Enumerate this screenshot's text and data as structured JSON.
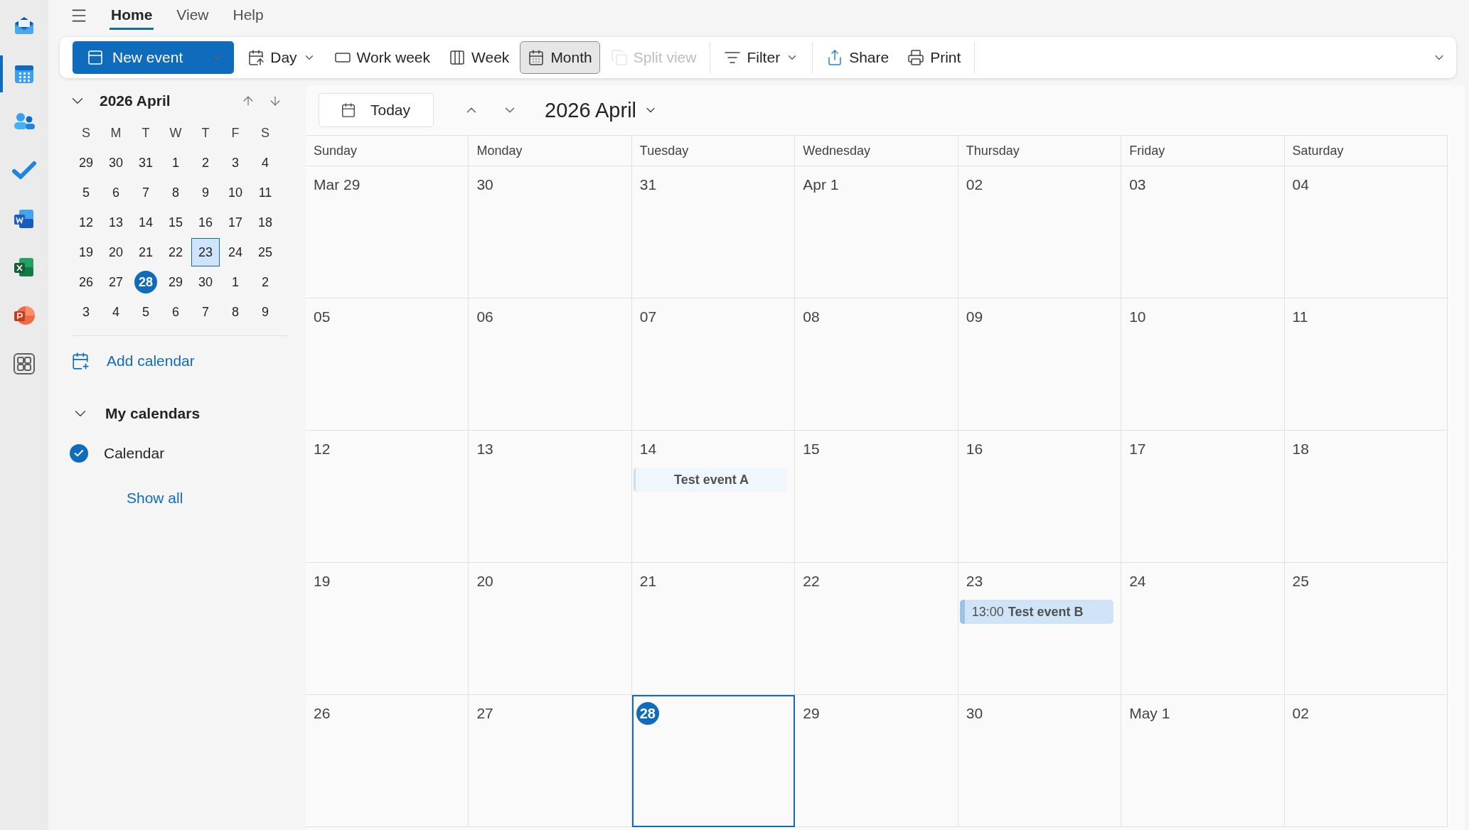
{
  "app_rail": [
    {
      "kind": "mail",
      "selected": false
    },
    {
      "kind": "calendar",
      "selected": true
    },
    {
      "kind": "people",
      "selected": false
    },
    {
      "kind": "todo",
      "selected": false
    },
    {
      "kind": "word",
      "selected": false
    },
    {
      "kind": "excel",
      "selected": false
    },
    {
      "kind": "powerpoint",
      "selected": false
    },
    {
      "kind": "apps",
      "selected": false
    }
  ],
  "menu_tabs": [
    {
      "label": "Home",
      "selected": true
    },
    {
      "label": "View",
      "selected": false
    },
    {
      "label": "Help",
      "selected": false
    }
  ],
  "toolbar": {
    "groups": [
      {
        "buttons": [
          {
            "label": "New event",
            "kind": "new",
            "dropdown": true,
            "selected": false,
            "disabled": false
          },
          {
            "label": "Day",
            "kind": "day",
            "dropdown": true,
            "selected": false,
            "disabled": false
          },
          {
            "label": "Work week",
            "kind": "workweek",
            "dropdown": false,
            "selected": false,
            "disabled": false
          },
          {
            "label": "Week",
            "kind": "week",
            "dropdown": false,
            "selected": false,
            "disabled": false
          },
          {
            "label": "Month",
            "kind": "month",
            "dropdown": false,
            "selected": true,
            "disabled": false
          },
          {
            "label": "Split view",
            "kind": "split",
            "dropdown": false,
            "selected": false,
            "disabled": true
          }
        ]
      },
      {
        "buttons": [
          {
            "label": "Filter",
            "kind": "filter",
            "dropdown": true,
            "selected": false,
            "disabled": false
          }
        ]
      },
      {
        "buttons": [
          {
            "label": "Share",
            "kind": "share",
            "dropdown": false,
            "selected": false,
            "disabled": false
          },
          {
            "label": "Print",
            "kind": "print",
            "dropdown": false,
            "selected": false,
            "disabled": false
          }
        ]
      }
    ]
  },
  "mini_calendar": {
    "title": "2026 April",
    "weekdays": [
      "S",
      "M",
      "T",
      "W",
      "T",
      "F",
      "S"
    ],
    "weeks": [
      {
        "days": [
          {
            "label": "29",
            "selected": false,
            "today": false
          },
          {
            "label": "30",
            "selected": false,
            "today": false
          },
          {
            "label": "31",
            "selected": false,
            "today": false
          },
          {
            "label": "1",
            "selected": false,
            "today": false
          },
          {
            "label": "2",
            "selected": false,
            "today": false
          },
          {
            "label": "3",
            "selected": false,
            "today": false
          },
          {
            "label": "4",
            "selected": false,
            "today": false
          }
        ]
      },
      {
        "days": [
          {
            "label": "5",
            "selected": false,
            "today": false
          },
          {
            "label": "6",
            "selected": false,
            "today": false
          },
          {
            "label": "7",
            "selected": false,
            "today": false
          },
          {
            "label": "8",
            "selected": false,
            "today": false
          },
          {
            "label": "9",
            "selected": false,
            "today": false
          },
          {
            "label": "10",
            "selected": false,
            "today": false
          },
          {
            "label": "11",
            "selected": false,
            "today": false
          }
        ]
      },
      {
        "days": [
          {
            "label": "12",
            "selected": false,
            "today": false
          },
          {
            "label": "13",
            "selected": false,
            "today": false
          },
          {
            "label": "14",
            "selected": false,
            "today": false
          },
          {
            "label": "15",
            "selected": false,
            "today": false
          },
          {
            "label": "16",
            "selected": false,
            "today": false
          },
          {
            "label": "17",
            "selected": false,
            "today": false
          },
          {
            "label": "18",
            "selected": false,
            "today": false
          }
        ]
      },
      {
        "days": [
          {
            "label": "19",
            "selected": false,
            "today": false
          },
          {
            "label": "20",
            "selected": false,
            "today": false
          },
          {
            "label": "21",
            "selected": false,
            "today": false
          },
          {
            "label": "22",
            "selected": false,
            "today": false
          },
          {
            "label": "23",
            "selected": true,
            "today": false
          },
          {
            "label": "24",
            "selected": false,
            "today": false
          },
          {
            "label": "25",
            "selected": false,
            "today": false
          }
        ]
      },
      {
        "days": [
          {
            "label": "26",
            "selected": false,
            "today": false
          },
          {
            "label": "27",
            "selected": false,
            "today": false
          },
          {
            "label": "28",
            "selected": false,
            "today": true
          },
          {
            "label": "29",
            "selected": false,
            "today": false
          },
          {
            "label": "30",
            "selected": false,
            "today": false
          },
          {
            "label": "1",
            "selected": false,
            "today": false
          },
          {
            "label": "2",
            "selected": false,
            "today": false
          }
        ]
      },
      {
        "days": [
          {
            "label": "3",
            "selected": false,
            "today": false
          },
          {
            "label": "4",
            "selected": false,
            "today": false
          },
          {
            "label": "5",
            "selected": false,
            "today": false
          },
          {
            "label": "6",
            "selected": false,
            "today": false
          },
          {
            "label": "7",
            "selected": false,
            "today": false
          },
          {
            "label": "8",
            "selected": false,
            "today": false
          },
          {
            "label": "9",
            "selected": false,
            "today": false
          }
        ]
      }
    ]
  },
  "add_calendar": "Add calendar",
  "my_calendars": {
    "title": "My calendars",
    "expanded": true,
    "calendars": [
      {
        "name": "Calendar",
        "checked": true
      }
    ],
    "show_all": "Show all"
  },
  "main": {
    "today_button": "Today",
    "title": "2026 April",
    "columns": [
      "Sunday",
      "Monday",
      "Tuesday",
      "Wednesday",
      "Thursday",
      "Friday",
      "Saturday"
    ],
    "weeks": [
      {
        "days": [
          {
            "label": "Mar 29",
            "today": false
          },
          {
            "label": "30",
            "today": false
          },
          {
            "label": "31",
            "today": false
          },
          {
            "label": "Apr 1",
            "today": false
          },
          {
            "label": "02",
            "today": false
          },
          {
            "label": "03",
            "today": false
          },
          {
            "label": "04",
            "today": false
          }
        ]
      },
      {
        "days": [
          {
            "label": "05",
            "today": false
          },
          {
            "label": "06",
            "today": false
          },
          {
            "label": "07",
            "today": false
          },
          {
            "label": "08",
            "today": false
          },
          {
            "label": "09",
            "today": false
          },
          {
            "label": "10",
            "today": false
          },
          {
            "label": "11",
            "today": false
          }
        ]
      },
      {
        "days": [
          {
            "label": "12",
            "today": false
          },
          {
            "label": "13",
            "today": false
          },
          {
            "label": "14",
            "today": false,
            "events": [
              {
                "kind": "outlined",
                "title": "Test event A"
              }
            ]
          },
          {
            "label": "15",
            "today": false
          },
          {
            "label": "16",
            "today": false
          },
          {
            "label": "17",
            "today": false
          },
          {
            "label": "18",
            "today": false
          }
        ]
      },
      {
        "days": [
          {
            "label": "19",
            "today": false
          },
          {
            "label": "20",
            "today": false
          },
          {
            "label": "21",
            "today": false
          },
          {
            "label": "22",
            "today": false
          },
          {
            "label": "23",
            "today": false,
            "events": [
              {
                "kind": "filled",
                "time": "13:00",
                "title": "Test event B"
              }
            ]
          },
          {
            "label": "24",
            "today": false
          },
          {
            "label": "25",
            "today": false
          }
        ]
      },
      {
        "days": [
          {
            "label": "26",
            "today": false
          },
          {
            "label": "27",
            "today": false
          },
          {
            "label": "28",
            "today": true
          },
          {
            "label": "29",
            "today": false
          },
          {
            "label": "30",
            "today": false
          },
          {
            "label": "May 1",
            "today": false
          },
          {
            "label": "02",
            "today": false
          }
        ]
      }
    ]
  }
}
